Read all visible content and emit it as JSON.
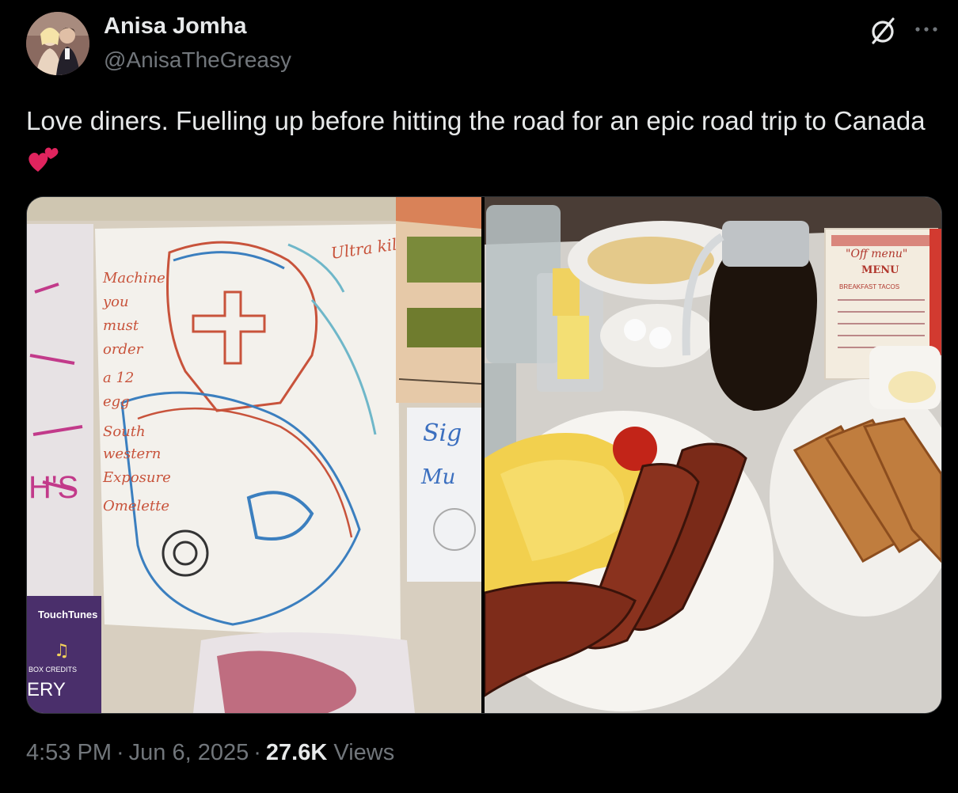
{
  "author": {
    "name": "Anisa Jomha",
    "handle": "@AnisaTheGreasy"
  },
  "header": {
    "grok_icon": "grok-slash-circle-icon",
    "more_icon": "more-dots-icon"
  },
  "tweet": {
    "text": "Love diners. Fuelling up before hitting the road for an epic road trip to Canada",
    "emoji": "two-hearts-emoji"
  },
  "media": {
    "left_photo": {
      "drawing_text": {
        "lines": [
          "Machine",
          "you",
          "must",
          "order",
          "a 12",
          "egg",
          "South",
          "western",
          "Exposure",
          "Omelette"
        ],
        "corner_text": "Ultra kill"
      },
      "side_sign": [
        "Sig",
        "Mu"
      ],
      "jukebox": {
        "brand": "TouchTunes",
        "sub": "BOX CREDITS",
        "big": "ERY"
      }
    },
    "right_photo": {
      "menu_card": {
        "title": "\"Off menu\"",
        "subtitle": "MENU",
        "line1": "BREAKFAST TACOS"
      }
    }
  },
  "meta": {
    "time": "4:53 PM",
    "date": "Jun 6, 2025",
    "views_count": "27.6K",
    "views_label": "Views",
    "separator": "·"
  },
  "colors": {
    "background": "#000000",
    "primary_text": "#e7e9ea",
    "secondary_text": "#71767b",
    "border": "#2f3336"
  }
}
